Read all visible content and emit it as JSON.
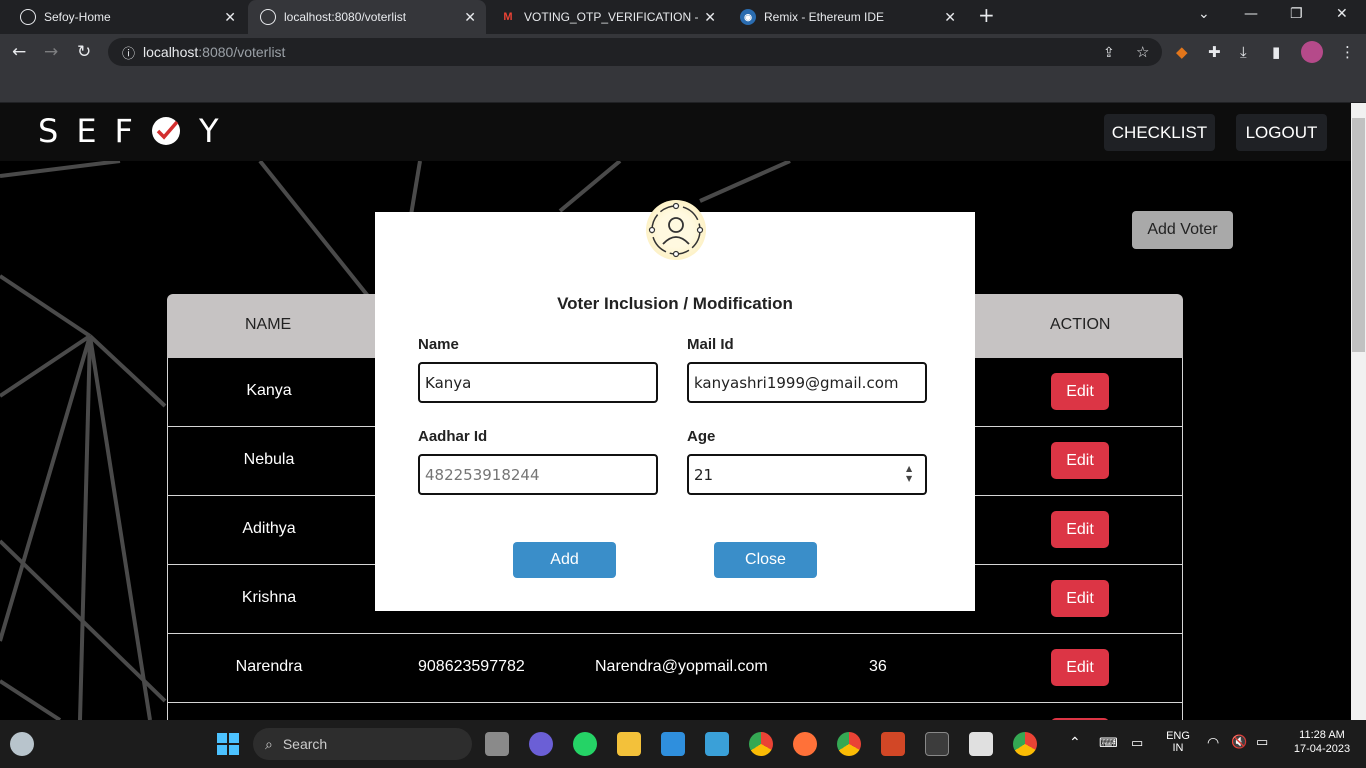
{
  "browser": {
    "tabs": [
      {
        "title": "Sefoy-Home",
        "icon": "globe-icon",
        "active": false
      },
      {
        "title": "localhost:8080/voterlist",
        "icon": "globe-icon",
        "active": true
      },
      {
        "title": "VOTING_OTP_VERIFICATION - shr",
        "icon": "gmail-icon",
        "active": false
      },
      {
        "title": "Remix - Ethereum IDE",
        "icon": "remix-icon",
        "active": false
      }
    ],
    "url_host": "localhost",
    "url_path": ":8080/voterlist"
  },
  "header": {
    "logo_left": "SEF",
    "logo_right": "Y",
    "checklist_label": "CHECKLIST",
    "logout_label": "LOGOUT"
  },
  "add_voter_label": "Add Voter",
  "table": {
    "headers": {
      "name": "NAME",
      "action": "ACTION"
    },
    "rows": [
      {
        "name": "Kanya",
        "aadhar": "",
        "mail": "",
        "age": ""
      },
      {
        "name": "Nebula",
        "aadhar": "",
        "mail": "",
        "age": ""
      },
      {
        "name": "Adithya",
        "aadhar": "",
        "mail": "",
        "age": ""
      },
      {
        "name": "Krishna",
        "aadhar": "",
        "mail": "",
        "age": ""
      },
      {
        "name": "Narendra",
        "aadhar": "908623597782",
        "mail": "Narendra@yopmail.com",
        "age": "36"
      }
    ],
    "edit_label": "Edit"
  },
  "modal": {
    "title": "Voter Inclusion / Modification",
    "name_label": "Name",
    "name_value": "Kanya",
    "mail_label": "Mail Id",
    "mail_value": "kanyashri1999@gmail.com",
    "aadhar_label": "Aadhar Id",
    "aadhar_placeholder": "482253918244",
    "age_label": "Age",
    "age_value": "21",
    "add_label": "Add",
    "close_label": "Close"
  },
  "taskbar": {
    "search_label": "Search",
    "lang_top": "ENG",
    "lang_bottom": "IN",
    "time": "11:28 AM",
    "date": "17-04-2023"
  }
}
